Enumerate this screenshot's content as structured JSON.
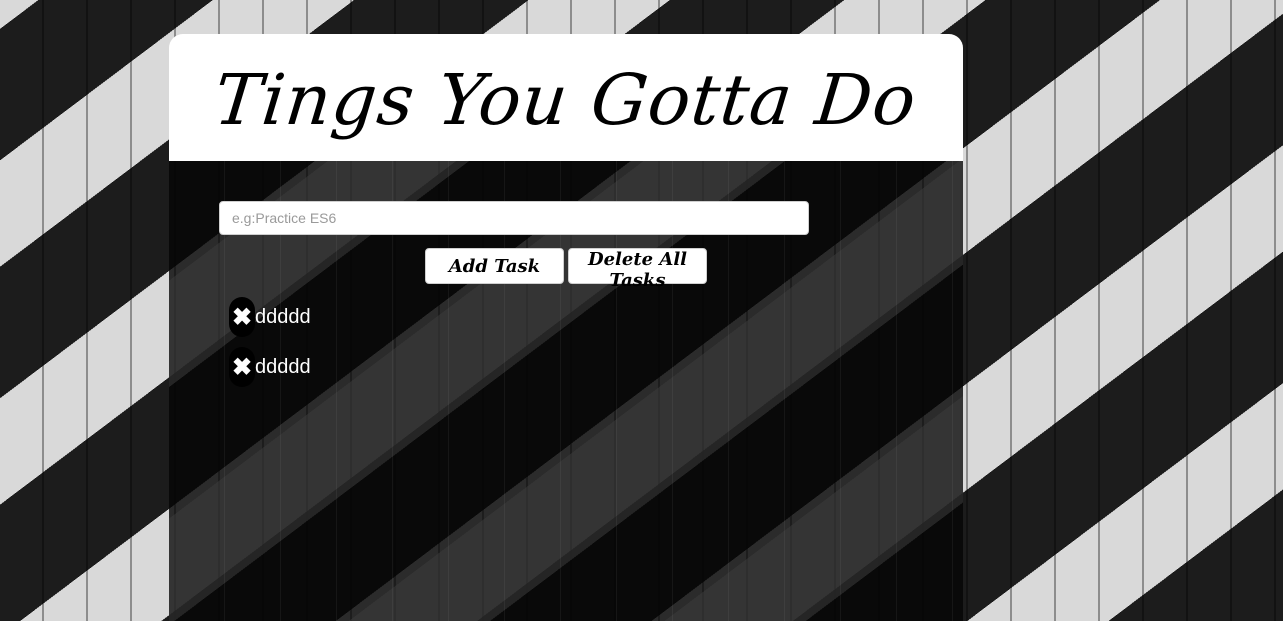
{
  "header": {
    "title": "Tings You Gotta Do"
  },
  "form": {
    "input_placeholder": "e.g:Practice ES6",
    "input_value": "",
    "add_label": "Add Task",
    "delete_all_label": "Delete All Tasks"
  },
  "tasks": [
    {
      "remove_icon": "✖",
      "text": "ddddd"
    },
    {
      "remove_icon": "✖",
      "text": "ddddd"
    }
  ]
}
